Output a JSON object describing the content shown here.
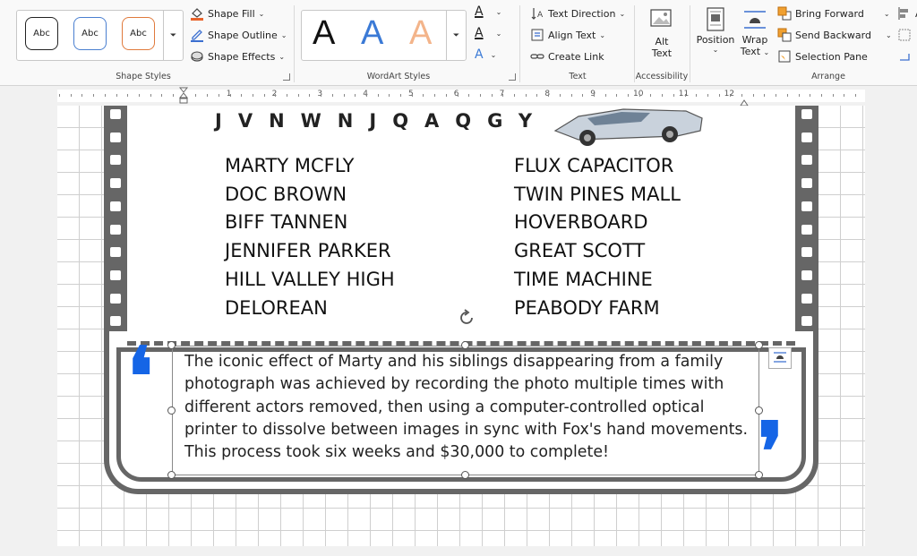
{
  "ribbon": {
    "shape_styles": {
      "samples": [
        "Abc",
        "Abc",
        "Abc"
      ],
      "sample_colors": [
        "#222222",
        "#4a7fd0",
        "#e07a3c"
      ],
      "group_label": "Shape Styles",
      "shape_fill": "Shape Fill",
      "shape_outline": "Shape Outline",
      "shape_effects": "Shape Effects"
    },
    "wordart": {
      "letters": [
        "A",
        "A",
        "A"
      ],
      "letter_colors": [
        "#111111",
        "#3b7ad6",
        "#f3b48a"
      ],
      "group_label": "WordArt Styles"
    },
    "text": {
      "text_direction": "Text Direction",
      "align_text": "Align Text",
      "create_link": "Create Link",
      "group_label": "Text",
      "text_fill_glyph": "A",
      "text_outline_glyph": "A",
      "text_effects_glyph": "A"
    },
    "accessibility": {
      "alt_text_line1": "Alt",
      "alt_text_line2": "Text",
      "group_label": "Accessibility"
    },
    "arrange": {
      "position": "Position",
      "wrap_text_line1": "Wrap",
      "wrap_text_line2": "Text",
      "bring_forward": "Bring Forward",
      "send_backward": "Send Backward",
      "selection_pane": "Selection Pane",
      "group_label": "Arrange",
      "align_partial": "A"
    }
  },
  "ruler": {
    "numbers": [
      "1",
      "2",
      "3",
      "4",
      "5",
      "6",
      "7",
      "8",
      "9",
      "10",
      "11",
      "12"
    ]
  },
  "document": {
    "letter_row": "JVNWNJQAQGY",
    "words_left": [
      "MARTY MCFLY",
      "DOC BROWN",
      "BIFF TANNEN",
      "JENNIFER PARKER",
      "HILL VALLEY HIGH",
      "DELOREAN"
    ],
    "words_right": [
      "FLUX CAPACITOR",
      "TWIN PINES MALL",
      "HOVERBOARD",
      "GREAT SCOTT",
      "TIME MACHINE",
      "PEABODY FARM"
    ],
    "quote_lines": [
      "The iconic effect of Marty and his siblings disappearing from a family",
      "photograph was achieved by recording the photo multiple times with",
      "different actors removed, then using a computer-controlled optical",
      "printer to dissolve between images in sync with Fox's hand movements.",
      "This process took six weeks and $30,000 to complete!"
    ],
    "open_quote": "❛",
    "close_quote": "❜",
    "accent_color": "#1565e6",
    "frame_color": "#666666"
  }
}
